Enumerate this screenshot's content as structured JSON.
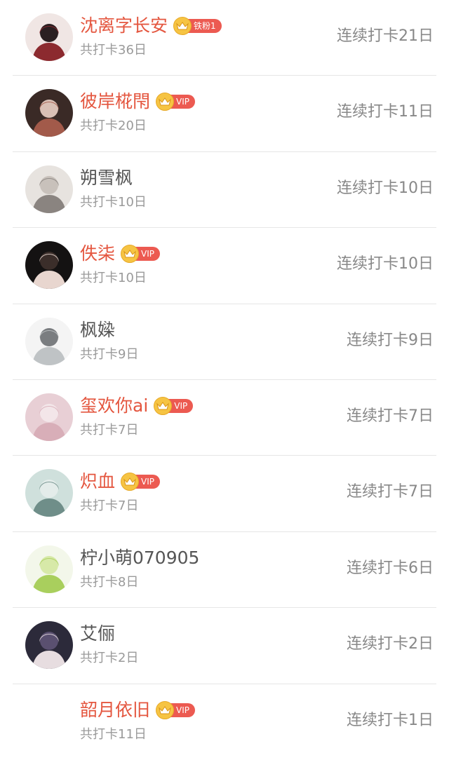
{
  "checkin_list": [
    {
      "name": "沈离字长安",
      "vip": true,
      "badge_icon": "crown-icon",
      "badge_label": "铁粉1",
      "total": "共打卡36日",
      "streak": "连续打卡21日",
      "avatar": {
        "has_image": true,
        "bg": "#f0e6e4",
        "fg": "#8c2a2f",
        "accent": "#2b1f21"
      }
    },
    {
      "name": "彼岸椛閇",
      "vip": true,
      "badge_icon": "crown-icon",
      "badge_label": "VIP",
      "total": "共打卡20日",
      "streak": "连续打卡11日",
      "avatar": {
        "has_image": true,
        "bg": "#3a2a26",
        "fg": "#a25a4a",
        "accent": "#d9c0b5"
      }
    },
    {
      "name": "朔雪枫",
      "vip": false,
      "badge_icon": "",
      "badge_label": "",
      "total": "共打卡10日",
      "streak": "连续打卡10日",
      "avatar": {
        "has_image": true,
        "bg": "#e7e3df",
        "fg": "#8a8480",
        "accent": "#c8c1bb"
      }
    },
    {
      "name": "佚柒",
      "vip": true,
      "badge_icon": "crown-icon",
      "badge_label": "VIP",
      "total": "共打卡10日",
      "streak": "连续打卡10日",
      "avatar": {
        "has_image": true,
        "bg": "#141212",
        "fg": "#e8d6cf",
        "accent": "#3b2e2a"
      }
    },
    {
      "name": "枫媣",
      "vip": false,
      "badge_icon": "",
      "badge_label": "",
      "total": "共打卡9日",
      "streak": "连续打卡9日",
      "avatar": {
        "has_image": true,
        "bg": "#f4f4f4",
        "fg": "#bfc3c5",
        "accent": "#7a7d80"
      }
    },
    {
      "name": "玺欢你ai",
      "vip": true,
      "badge_icon": "crown-icon",
      "badge_label": "VIP",
      "total": "共打卡7日",
      "streak": "连续打卡7日",
      "avatar": {
        "has_image": true,
        "bg": "#e8cfd5",
        "fg": "#d8aeb8",
        "accent": "#f3e6e9"
      }
    },
    {
      "name": "炽血",
      "vip": true,
      "badge_icon": "crown-icon",
      "badge_label": "VIP",
      "total": "共打卡7日",
      "streak": "连续打卡7日",
      "avatar": {
        "has_image": true,
        "bg": "#cfe0dc",
        "fg": "#6f8e89",
        "accent": "#e4ecea"
      }
    },
    {
      "name": "柠小萌070905",
      "vip": false,
      "badge_icon": "",
      "badge_label": "",
      "total": "共打卡8日",
      "streak": "连续打卡6日",
      "avatar": {
        "has_image": true,
        "bg": "#f3f7ea",
        "fg": "#a9cf5d",
        "accent": "#d7e9a8"
      }
    },
    {
      "name": "艾俪",
      "vip": false,
      "badge_icon": "",
      "badge_label": "",
      "total": "共打卡2日",
      "streak": "连续打卡2日",
      "avatar": {
        "has_image": true,
        "bg": "#2c2a3a",
        "fg": "#e7dde0",
        "accent": "#5a5070"
      }
    },
    {
      "name": "韶月依旧",
      "vip": true,
      "badge_icon": "crown-icon",
      "badge_label": "VIP",
      "total": "共打卡11日",
      "streak": "连续打卡1日",
      "avatar": {
        "has_image": false,
        "bg": "#ffffff",
        "fg": "#ffffff",
        "accent": "#ffffff"
      }
    }
  ],
  "colors": {
    "vip_name": "#e4563f",
    "normal_name": "#555555",
    "badge_red": "#ec5a51",
    "crown_gold": "#f6c443",
    "muted": "#9a9a9a",
    "divider": "#e6e6e6"
  }
}
